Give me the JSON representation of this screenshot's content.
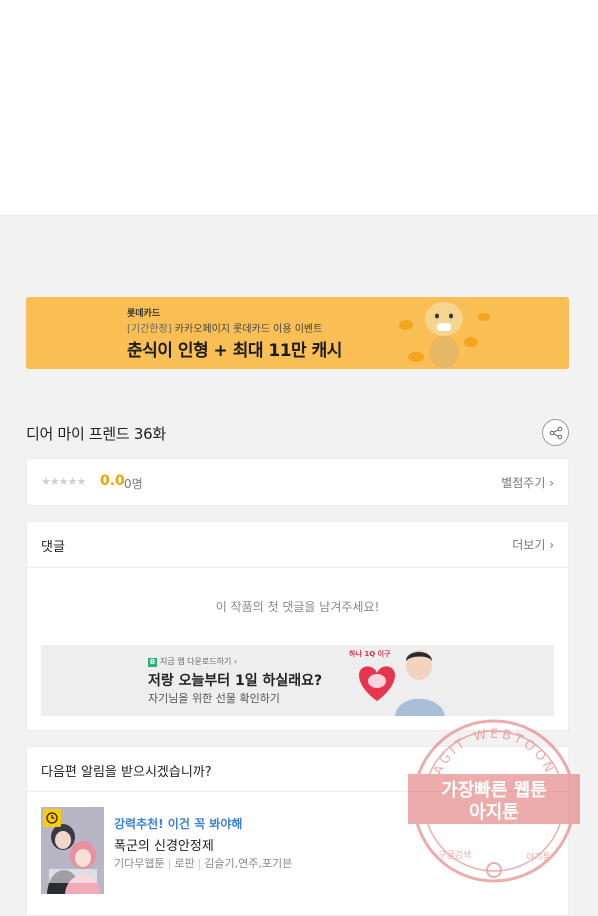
{
  "promo": {
    "brand": "롯데카드",
    "tag": "[기간한정]",
    "subtitle": "카카오페이지 롯데카드 이용 이벤트",
    "headline": "춘식이 인형 + 최대 11만 캐시"
  },
  "episode": {
    "title": "디어 마이 프렌드 36화"
  },
  "rating": {
    "stars": "★★★★★",
    "score": "0.0",
    "count": "0명",
    "rate_label": "별점주기 ›"
  },
  "comments": {
    "title": "댓글",
    "more_label": "더보기 ›",
    "empty_message": "이 작품의 첫 댓글을 남겨주세요!"
  },
  "ad": {
    "logo_text": "지금 앱 다운로드하기 ›",
    "logo_mark": "B",
    "badge": "하나 1Q 이구",
    "headline": "저랑 오늘부터 1일 하실래요?",
    "subline": "자기님을 위한 선물 확인하기"
  },
  "next": {
    "title": "다음편 알림을 받으시겠습니까?",
    "rec_tag": "강력추천! 이건 꼭 봐야해",
    "rec_name": "폭군의 신경안정제",
    "meta": [
      "기다무웹툰",
      "로판",
      "김슬기,연주,포기븐"
    ]
  },
  "watermark": {
    "arc_top": "AGIT WEBTOON",
    "line1": "가장빠른 웹툰",
    "line2": "아지툰",
    "arc_left": "구글검색",
    "arc_right": "아지툰"
  },
  "colors": {
    "promo_bg": "#f9bf55",
    "score": "#f0a400",
    "rec_tag": "#3b82d6",
    "stamp": "#e06a6a"
  }
}
